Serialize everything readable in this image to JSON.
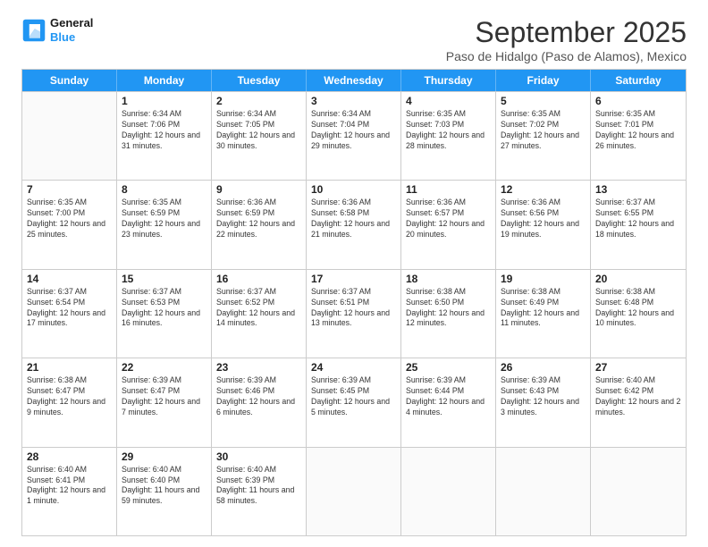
{
  "header": {
    "logo_line1": "General",
    "logo_line2": "Blue",
    "month_title": "September 2025",
    "subtitle": "Paso de Hidalgo (Paso de Alamos), Mexico"
  },
  "days_of_week": [
    "Sunday",
    "Monday",
    "Tuesday",
    "Wednesday",
    "Thursday",
    "Friday",
    "Saturday"
  ],
  "weeks": [
    [
      {
        "day": "",
        "info": ""
      },
      {
        "day": "1",
        "info": "Sunrise: 6:34 AM\nSunset: 7:06 PM\nDaylight: 12 hours\nand 31 minutes."
      },
      {
        "day": "2",
        "info": "Sunrise: 6:34 AM\nSunset: 7:05 PM\nDaylight: 12 hours\nand 30 minutes."
      },
      {
        "day": "3",
        "info": "Sunrise: 6:34 AM\nSunset: 7:04 PM\nDaylight: 12 hours\nand 29 minutes."
      },
      {
        "day": "4",
        "info": "Sunrise: 6:35 AM\nSunset: 7:03 PM\nDaylight: 12 hours\nand 28 minutes."
      },
      {
        "day": "5",
        "info": "Sunrise: 6:35 AM\nSunset: 7:02 PM\nDaylight: 12 hours\nand 27 minutes."
      },
      {
        "day": "6",
        "info": "Sunrise: 6:35 AM\nSunset: 7:01 PM\nDaylight: 12 hours\nand 26 minutes."
      }
    ],
    [
      {
        "day": "7",
        "info": "Sunrise: 6:35 AM\nSunset: 7:00 PM\nDaylight: 12 hours\nand 25 minutes."
      },
      {
        "day": "8",
        "info": "Sunrise: 6:35 AM\nSunset: 6:59 PM\nDaylight: 12 hours\nand 23 minutes."
      },
      {
        "day": "9",
        "info": "Sunrise: 6:36 AM\nSunset: 6:59 PM\nDaylight: 12 hours\nand 22 minutes."
      },
      {
        "day": "10",
        "info": "Sunrise: 6:36 AM\nSunset: 6:58 PM\nDaylight: 12 hours\nand 21 minutes."
      },
      {
        "day": "11",
        "info": "Sunrise: 6:36 AM\nSunset: 6:57 PM\nDaylight: 12 hours\nand 20 minutes."
      },
      {
        "day": "12",
        "info": "Sunrise: 6:36 AM\nSunset: 6:56 PM\nDaylight: 12 hours\nand 19 minutes."
      },
      {
        "day": "13",
        "info": "Sunrise: 6:37 AM\nSunset: 6:55 PM\nDaylight: 12 hours\nand 18 minutes."
      }
    ],
    [
      {
        "day": "14",
        "info": "Sunrise: 6:37 AM\nSunset: 6:54 PM\nDaylight: 12 hours\nand 17 minutes."
      },
      {
        "day": "15",
        "info": "Sunrise: 6:37 AM\nSunset: 6:53 PM\nDaylight: 12 hours\nand 16 minutes."
      },
      {
        "day": "16",
        "info": "Sunrise: 6:37 AM\nSunset: 6:52 PM\nDaylight: 12 hours\nand 14 minutes."
      },
      {
        "day": "17",
        "info": "Sunrise: 6:37 AM\nSunset: 6:51 PM\nDaylight: 12 hours\nand 13 minutes."
      },
      {
        "day": "18",
        "info": "Sunrise: 6:38 AM\nSunset: 6:50 PM\nDaylight: 12 hours\nand 12 minutes."
      },
      {
        "day": "19",
        "info": "Sunrise: 6:38 AM\nSunset: 6:49 PM\nDaylight: 12 hours\nand 11 minutes."
      },
      {
        "day": "20",
        "info": "Sunrise: 6:38 AM\nSunset: 6:48 PM\nDaylight: 12 hours\nand 10 minutes."
      }
    ],
    [
      {
        "day": "21",
        "info": "Sunrise: 6:38 AM\nSunset: 6:47 PM\nDaylight: 12 hours\nand 9 minutes."
      },
      {
        "day": "22",
        "info": "Sunrise: 6:39 AM\nSunset: 6:47 PM\nDaylight: 12 hours\nand 7 minutes."
      },
      {
        "day": "23",
        "info": "Sunrise: 6:39 AM\nSunset: 6:46 PM\nDaylight: 12 hours\nand 6 minutes."
      },
      {
        "day": "24",
        "info": "Sunrise: 6:39 AM\nSunset: 6:45 PM\nDaylight: 12 hours\nand 5 minutes."
      },
      {
        "day": "25",
        "info": "Sunrise: 6:39 AM\nSunset: 6:44 PM\nDaylight: 12 hours\nand 4 minutes."
      },
      {
        "day": "26",
        "info": "Sunrise: 6:39 AM\nSunset: 6:43 PM\nDaylight: 12 hours\nand 3 minutes."
      },
      {
        "day": "27",
        "info": "Sunrise: 6:40 AM\nSunset: 6:42 PM\nDaylight: 12 hours\nand 2 minutes."
      }
    ],
    [
      {
        "day": "28",
        "info": "Sunrise: 6:40 AM\nSunset: 6:41 PM\nDaylight: 12 hours\nand 1 minute."
      },
      {
        "day": "29",
        "info": "Sunrise: 6:40 AM\nSunset: 6:40 PM\nDaylight: 11 hours\nand 59 minutes."
      },
      {
        "day": "30",
        "info": "Sunrise: 6:40 AM\nSunset: 6:39 PM\nDaylight: 11 hours\nand 58 minutes."
      },
      {
        "day": "",
        "info": ""
      },
      {
        "day": "",
        "info": ""
      },
      {
        "day": "",
        "info": ""
      },
      {
        "day": "",
        "info": ""
      }
    ]
  ]
}
